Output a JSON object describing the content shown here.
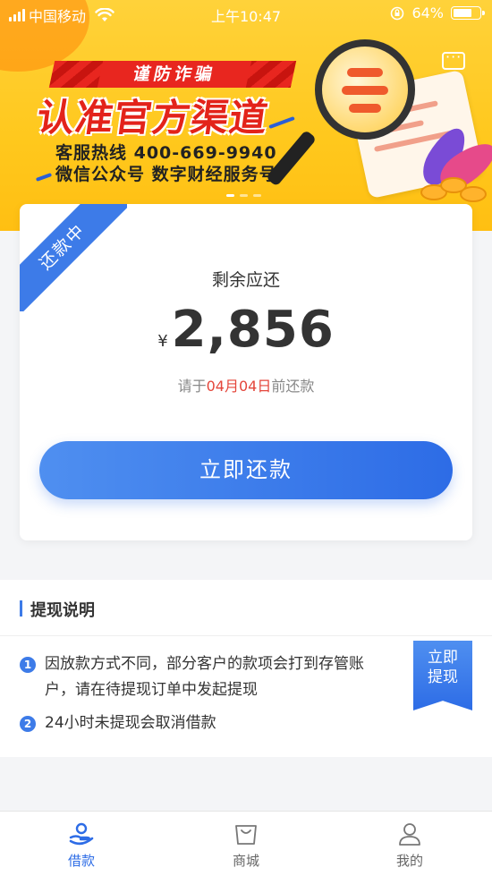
{
  "status_bar": {
    "carrier": "中国移动",
    "time": "上午10:47",
    "battery": "64%"
  },
  "banner": {
    "caution": "谨防诈骗",
    "headline": "认准官方渠道",
    "hotline": "客服热线 400-669-9940",
    "wechat": "微信公众号 数字财经服务号",
    "icons": [
      "message-icon",
      "magnifier-illustration"
    ]
  },
  "repay_card": {
    "status_ribbon": "还款中",
    "remaining_label": "剩余应还",
    "currency": "¥",
    "amount": "2,856",
    "due_prefix": "请于",
    "due_date": "04月04日",
    "due_suffix": "前还款",
    "button_label": "立即还款"
  },
  "withdraw_notes": {
    "title": "提现说明",
    "items": [
      {
        "index": "1",
        "text": "因放款方式不同，部分客户的款项会打到存管账户，请在待提现订单中发起提现"
      },
      {
        "index": "2",
        "text": "24小时未提现会取消借款"
      }
    ],
    "tag_line1": "立即",
    "tag_line2": "提现"
  },
  "tab_bar": {
    "items": [
      {
        "label": "借款",
        "icon": "loan-hand-icon",
        "active": true
      },
      {
        "label": "商城",
        "icon": "shopping-bag-icon",
        "active": false
      },
      {
        "label": "我的",
        "icon": "user-icon",
        "active": false
      }
    ]
  },
  "colors": {
    "primary": "#2d6ce6",
    "banner_yellow": "#ffc81d",
    "alert_red": "#e4463b"
  }
}
